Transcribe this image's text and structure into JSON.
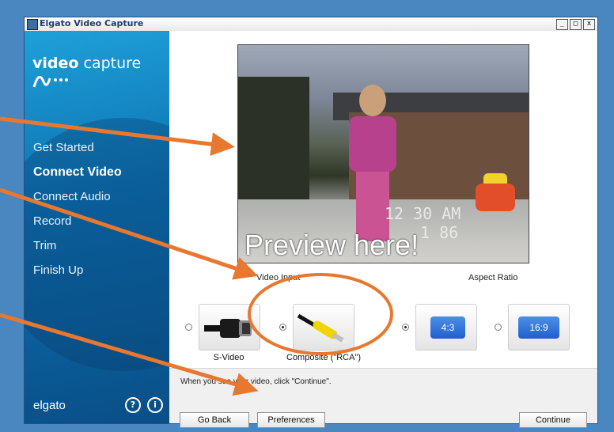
{
  "window": {
    "title": "Elgato Video Capture",
    "controls": {
      "minimize": "_",
      "maximize": "□",
      "close": "x"
    }
  },
  "sidebar": {
    "logo_bold": "video",
    "logo_light": "capture",
    "items": [
      {
        "label": "Get Started",
        "active": false
      },
      {
        "label": "Connect Video",
        "active": true
      },
      {
        "label": "Connect Audio",
        "active": false
      },
      {
        "label": "Record",
        "active": false
      },
      {
        "label": "Trim",
        "active": false
      },
      {
        "label": "Finish Up",
        "active": false
      }
    ],
    "brand": "elgato",
    "help_icon": "?",
    "info_icon": "i"
  },
  "preview": {
    "annotation": "Preview here!",
    "timestamp_line1": "12 30 AM",
    "timestamp_line2": "1 86"
  },
  "video_input": {
    "label": "Video Input",
    "options": [
      {
        "label": "S-Video",
        "selected": false,
        "icon": "s-video-connector-icon"
      },
      {
        "label": "Composite (\"RCA\")",
        "selected": true,
        "icon": "rca-connector-icon"
      }
    ]
  },
  "aspect_ratio": {
    "label": "Aspect Ratio",
    "options": [
      {
        "label": "4:3",
        "selected": true
      },
      {
        "label": "16:9",
        "selected": false
      }
    ]
  },
  "footer": {
    "hint": "When you see your video, click \"Continue\".",
    "go_back": "Go Back",
    "preferences": "Preferences",
    "continue": "Continue"
  },
  "colors": {
    "sidebar_top": "#1fa0d8",
    "sidebar_bottom": "#0a4e86",
    "annotation_arrow": "#e8782f",
    "aspect_button": "#2f6fd8"
  }
}
